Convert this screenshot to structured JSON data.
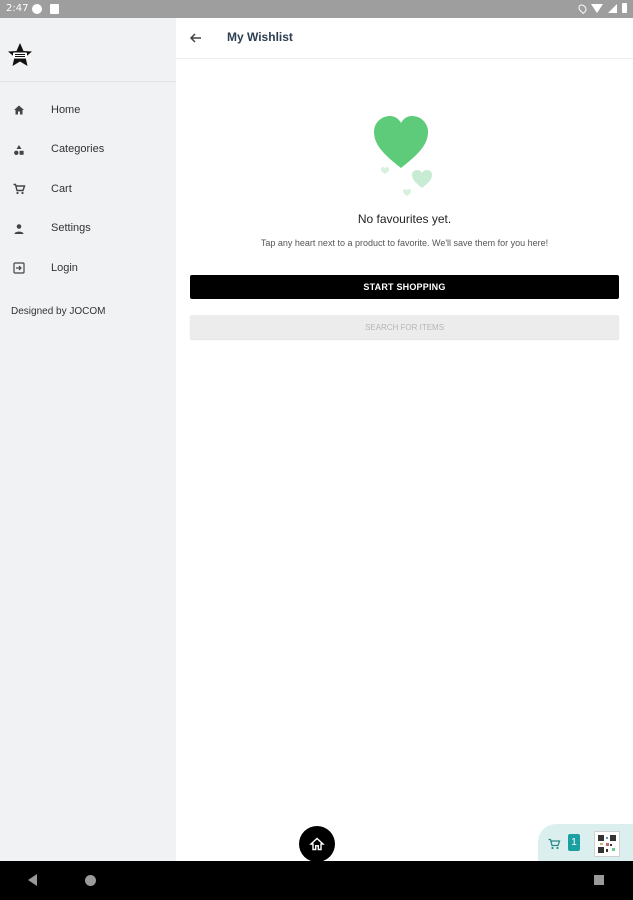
{
  "status_bar": {
    "time": "2:47",
    "icons": [
      "app-notification-icon",
      "sd-card-icon",
      "location-icon",
      "wifi-icon",
      "signal-icon",
      "battery-icon"
    ]
  },
  "sidebar": {
    "logo_icon": "star-brand-logo",
    "items": [
      {
        "label": "Home",
        "icon": "home-icon"
      },
      {
        "label": "Categories",
        "icon": "categories-icon"
      },
      {
        "label": "Cart",
        "icon": "cart-icon"
      },
      {
        "label": "Settings",
        "icon": "person-icon"
      },
      {
        "label": "Login",
        "icon": "login-icon"
      }
    ],
    "footer": "Designed by JOCOM"
  },
  "header": {
    "back_icon": "arrow-left-icon",
    "title": "My Wishlist"
  },
  "empty_state": {
    "illustration": "green-hearts-illustration",
    "title": "No favourites yet.",
    "subtitle": "Tap any heart next to a product to favorite. We'll save them for you here!"
  },
  "buttons": {
    "start_shopping": "START SHOPPING",
    "search_items": "SEARCH FOR ITEMS"
  },
  "floating_widget": {
    "cart_count": "1",
    "qr_icon": "qr-code-icon"
  },
  "colors": {
    "accent_green": "#5dcb7a",
    "light_green": "#c8ecd3",
    "sidebar_bg": "#f1f2f4",
    "primary_button": "#000000",
    "badge_teal": "#1aa0a0"
  }
}
